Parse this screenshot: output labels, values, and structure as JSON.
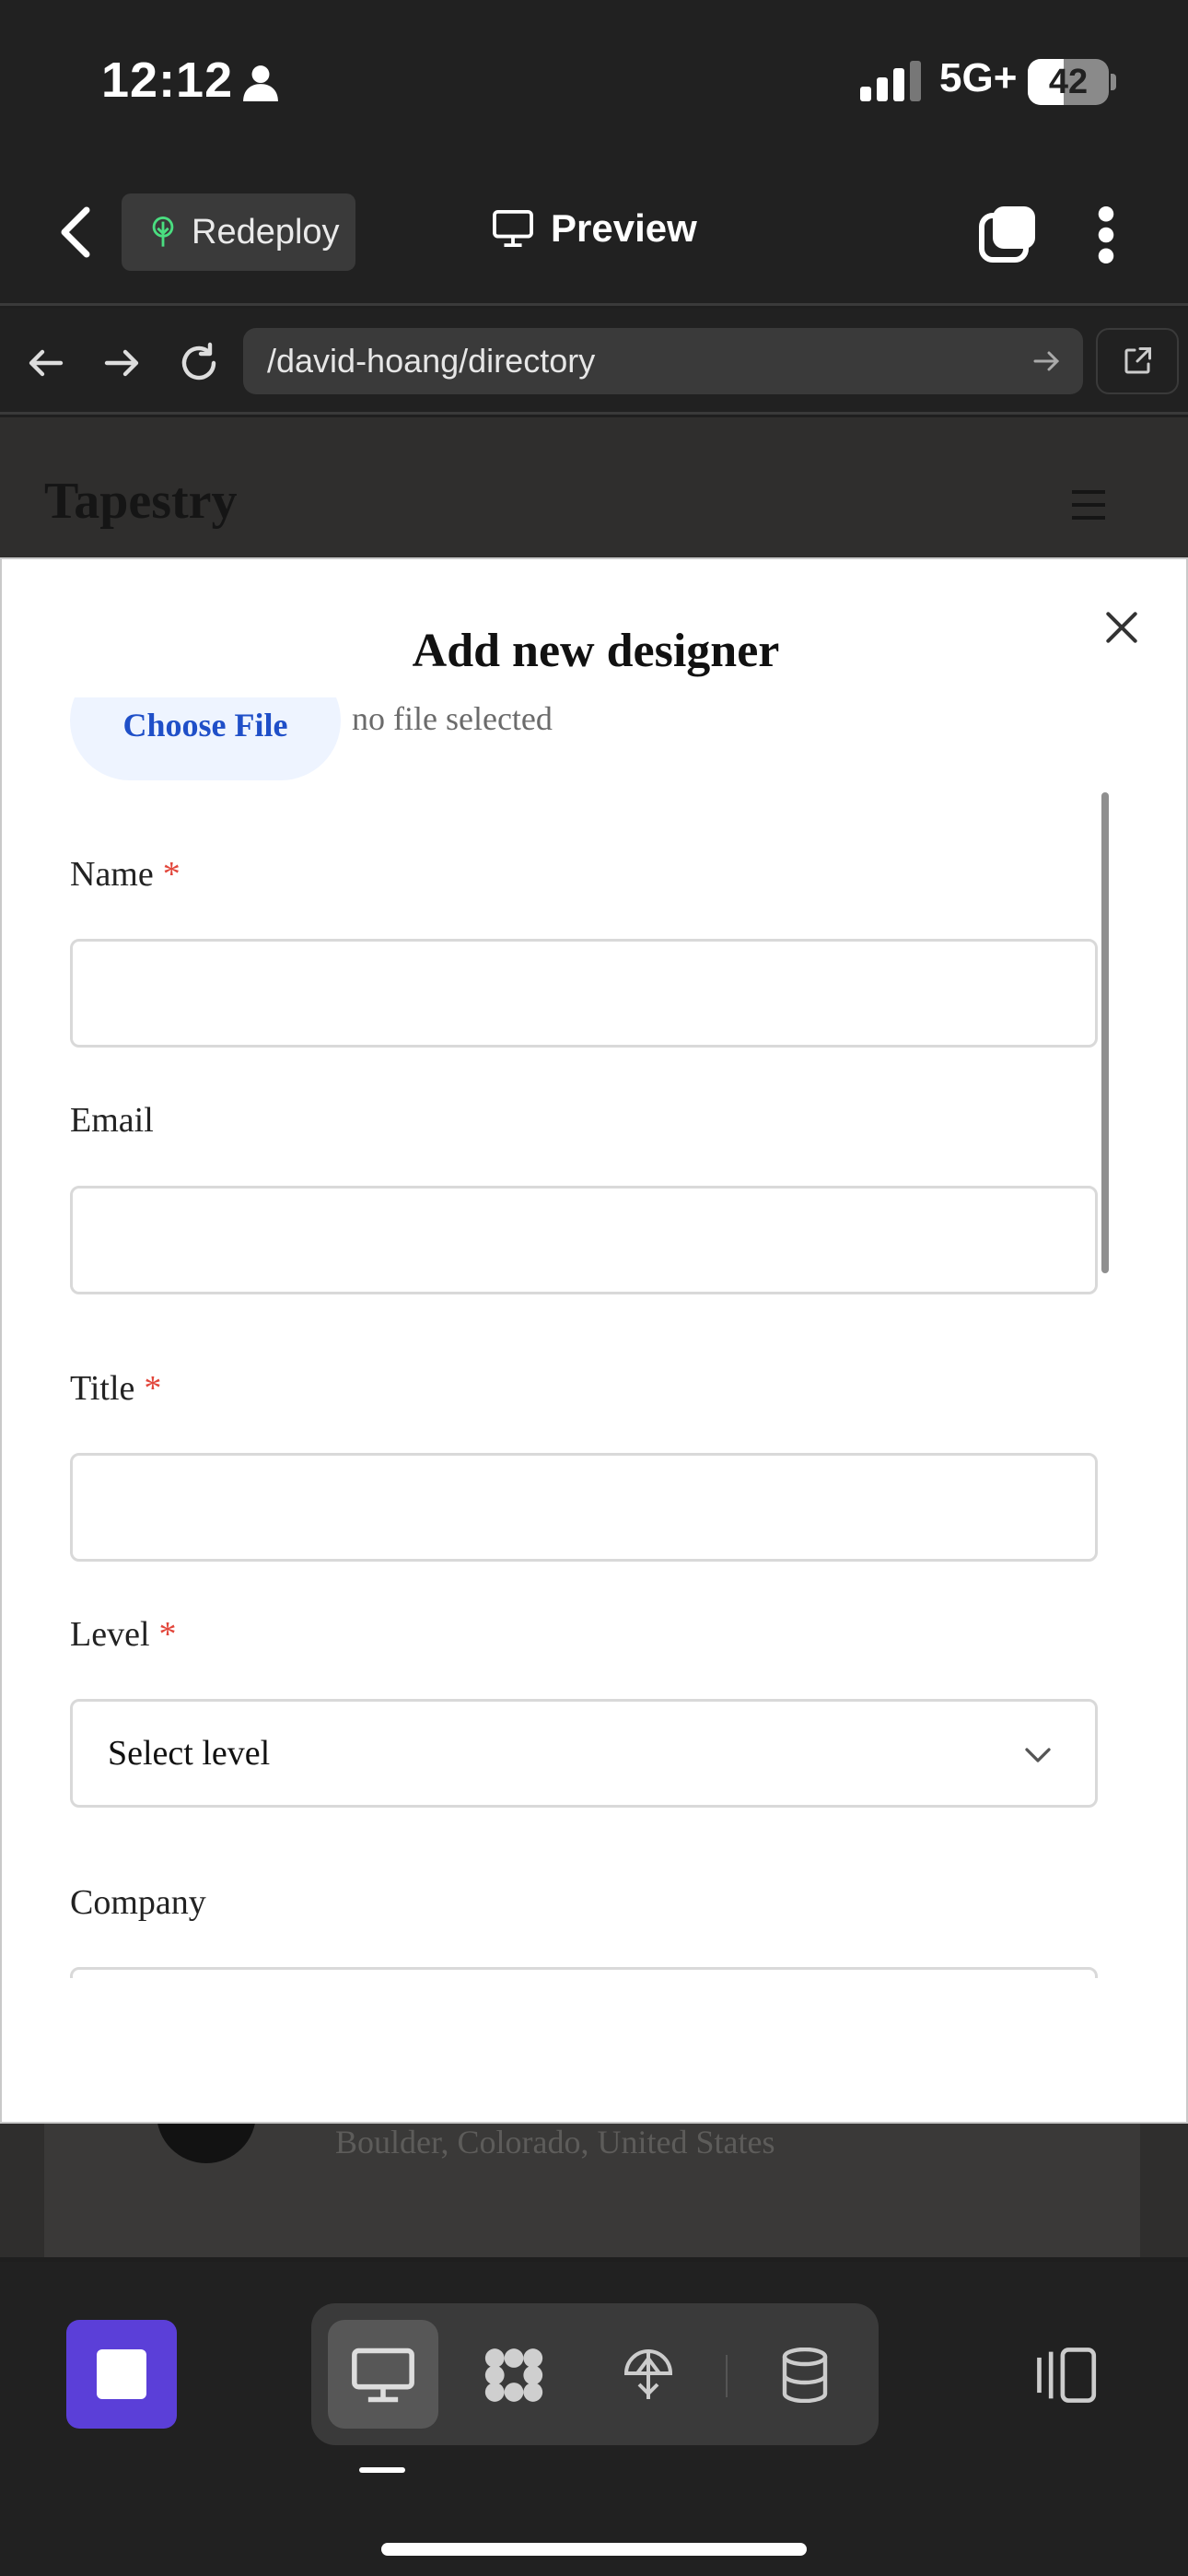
{
  "status_bar": {
    "time": "12:12",
    "network": "5G+",
    "battery": "42"
  },
  "header": {
    "redeploy_label": "Redeploy",
    "preview_label": "Preview"
  },
  "browser": {
    "url": "/david-hoang/directory"
  },
  "site": {
    "title": "Tapestry",
    "visible_location": "Boulder, Colorado, United States"
  },
  "modal": {
    "title": "Add new designer",
    "file": {
      "button_label": "Choose File",
      "status": "no file selected"
    },
    "fields": {
      "name": {
        "label": "Name",
        "required_mark": "*",
        "value": ""
      },
      "email": {
        "label": "Email",
        "value": ""
      },
      "title": {
        "label": "Title",
        "required_mark": "*",
        "value": ""
      },
      "level": {
        "label": "Level",
        "required_mark": "*",
        "selected": "Select level"
      },
      "company": {
        "label": "Company",
        "value": ""
      }
    }
  },
  "colors": {
    "accent": "#5b3fd8",
    "required": "#e2463b",
    "link": "#1f4fc8"
  },
  "icons": [
    "person-icon",
    "signal-icon",
    "battery-icon",
    "back-icon",
    "tree-icon",
    "monitor-icon",
    "tabs-icon",
    "more-icon",
    "arrow-left-icon",
    "arrow-right-icon",
    "reload-icon",
    "arrow-go-icon",
    "external-link-icon",
    "hamburger-icon",
    "close-icon",
    "chevron-down-icon",
    "stop-icon",
    "desktop-icon",
    "grid-flower-icon",
    "deploy-icon",
    "database-icon",
    "panel-icon"
  ]
}
